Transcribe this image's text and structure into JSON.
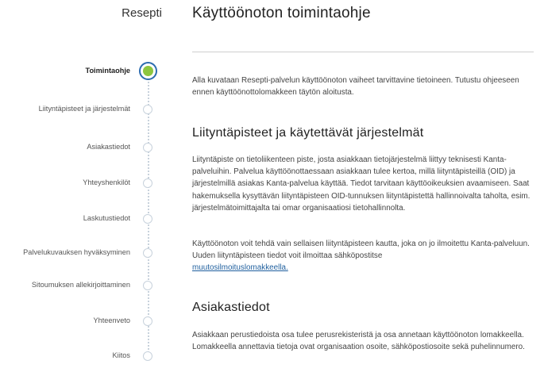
{
  "sidebar": {
    "title": "Resepti",
    "steps": [
      {
        "label": "Toimintaohje",
        "active": true
      },
      {
        "label": "Liityntäpisteet ja järjestelmät"
      },
      {
        "label": "Asiakastiedot"
      },
      {
        "label": "Yhteyshenkilöt"
      },
      {
        "label": "Laskutustiedot"
      },
      {
        "label": "Palvelukuvauksen hyväksyminen"
      },
      {
        "label": "Sitoumuksen allekirjoittaminen"
      },
      {
        "label": "Yhteenveto"
      },
      {
        "label": "Kiitos"
      }
    ]
  },
  "main": {
    "title": "Käyttöönoton toimintaohje",
    "intro": "Alla kuvataan Resepti-palvelun käyttöönoton vaiheet tarvittavine tietoineen. Tutustu ohjeeseen ennen käyttöönottolomakkeen täytön aloitusta.",
    "section1": {
      "heading": "Liityntäpisteet ja käytettävät järjestelmät",
      "text1": "Liityntäpiste on tietoliikenteen piste, josta asiakkaan tietojärjestelmä liittyy teknisesti Kanta-palveluihin. Palvelua käyttöönottaessaan asiakkaan tulee kertoa, millä liityntäpisteillä (OID) ja järjestelmillä asiakas Kanta-palvelua käyttää. Tiedot tarvitaan käyttöoikeuksien avaamiseen. Saat hakemuksella kysyttävän liityntäpisteen OID-tunnuksen liityntäpistettä hallinnoivalta taholta, esim. järjestelmätoimittajalta tai omar organisaatiosi tietohallinnolta.",
      "text2": "Käyttöönoton voit tehdä vain sellaisen liityntäpisteen kautta, joka on jo ilmoitettu Kanta-palveluun. Uuden liityntäpisteen tiedot voit ilmoittaa sähköpostitse ",
      "link": "muutosilmoituslomakkeella."
    },
    "section2": {
      "heading": "Asiakastiedot",
      "text": "Asiakkaan perustiedoista osa tulee perusrekisteristä ja osa annetaan käyttöönoton lomakkeella. Lomakkeella annettavia tietoja ovat organisaation osoite, sähköpostiosoite sekä puhelinnumero."
    }
  },
  "colors": {
    "active_ring": "#2c6cb0",
    "active_fill": "#8dc63f",
    "inactive_ring": "#c8d2dc",
    "link": "#1f5f9e"
  }
}
